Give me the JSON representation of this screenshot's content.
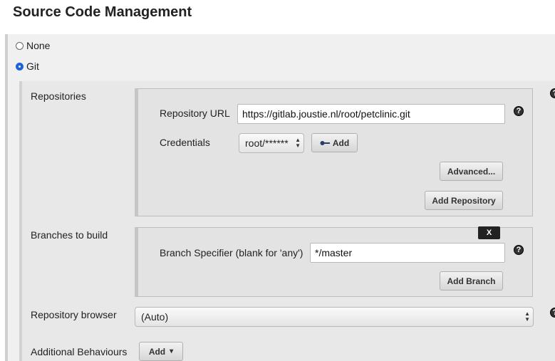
{
  "section_title": "Source Code Management",
  "scm_options": {
    "none_label": "None",
    "git_label": "Git",
    "selected": "Git"
  },
  "repositories": {
    "label": "Repositories",
    "repo_url_label": "Repository URL",
    "repo_url_value": "https://gitlab.joustie.nl/root/petclinic.git",
    "credentials_label": "Credentials",
    "credentials_value": "root/******",
    "add_credentials_label": "Add",
    "advanced_label": "Advanced...",
    "add_repository_label": "Add Repository"
  },
  "branches": {
    "label": "Branches to build",
    "delete_label": "X",
    "branch_specifier_label": "Branch Specifier (blank for 'any')",
    "branch_specifier_value": "*/master",
    "add_branch_label": "Add Branch"
  },
  "repository_browser": {
    "label": "Repository browser",
    "value": "(Auto)"
  },
  "additional_behaviours": {
    "label": "Additional Behaviours",
    "add_label": "Add",
    "add_caret": "▾"
  },
  "help_glyph": "?",
  "colors": {
    "radio_selected": "#1a64d6",
    "help_icon": "#333333"
  }
}
